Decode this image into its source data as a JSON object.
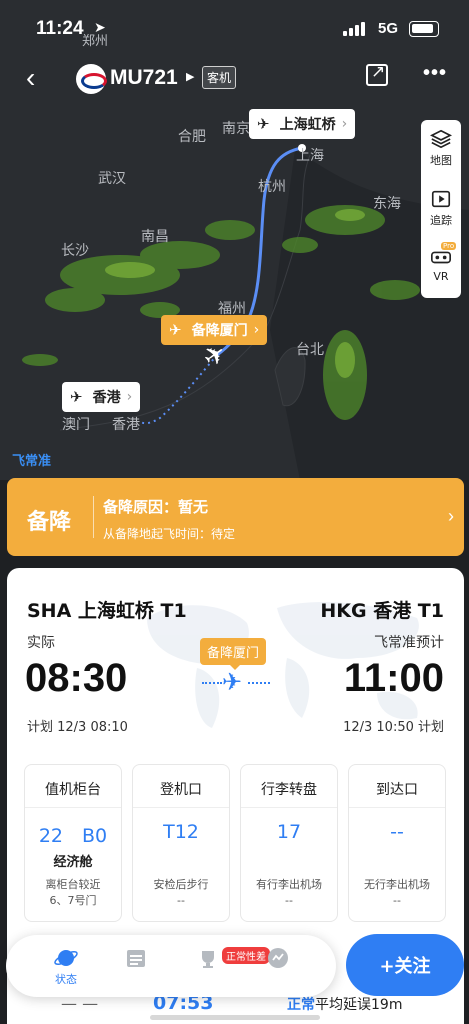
{
  "status_bar": {
    "time": "11:24",
    "network": "5G",
    "location_city": "郑州"
  },
  "nav": {
    "flight_no": "MU721",
    "cabin": "客机"
  },
  "map": {
    "cities": [
      "南京",
      "合肥",
      "上海",
      "武汉",
      "杭州",
      "东海",
      "长沙",
      "南昌",
      "福州",
      "台北",
      "澳门",
      "香港"
    ],
    "brand": "飞常准",
    "origin_tag": "上海虹桥",
    "divert_tag": "备降厦门",
    "dest_tag": "香港",
    "tools": {
      "layers": "地图",
      "track": "追踪",
      "vr": "VR",
      "vr_badge": "Pro"
    },
    "colors": {
      "route": "#5b8ef5",
      "divert": "#f3ad3d",
      "weather": "#5d9a2e"
    }
  },
  "divert_banner": {
    "title": "备降",
    "reason": "备降原因：暂无",
    "depart": "从备降地起飞时间：待定"
  },
  "flight": {
    "dep_code": "SHA 上海虹桥 T1",
    "arr_code": "HKG 香港 T1",
    "dep_status": "实际",
    "arr_status": "飞常准预计",
    "dep_time": "08:30",
    "arr_time": "11:00",
    "dep_plan": "计划 12/3 08:10",
    "arr_plan": "12/3 10:50 计划",
    "mid_badge": "备降厦门"
  },
  "info_boxes": [
    {
      "title": "值机柜台",
      "value": "22　B0",
      "sub": "经济舱",
      "note": "离柜台较近\n6、7号门"
    },
    {
      "title": "登机口",
      "value": "T12",
      "sub": "",
      "note": "安检后步行\n--"
    },
    {
      "title": "行李转盘",
      "value": "17",
      "sub": "",
      "note": "有行李出机场\n--"
    },
    {
      "title": "到达口",
      "value": "--",
      "sub": "",
      "note": "无行李出机场\n--"
    }
  ],
  "extra": {
    "dash": "— —",
    "time": "07:53",
    "ontime_label": "正常",
    "ontime_text": "平均延误19m"
  },
  "bottom_nav": {
    "items": [
      {
        "label": "状态"
      },
      {
        "label": ""
      },
      {
        "label": ""
      },
      {
        "label": ""
      }
    ],
    "badge": "正常性差",
    "follow": "+关注"
  }
}
